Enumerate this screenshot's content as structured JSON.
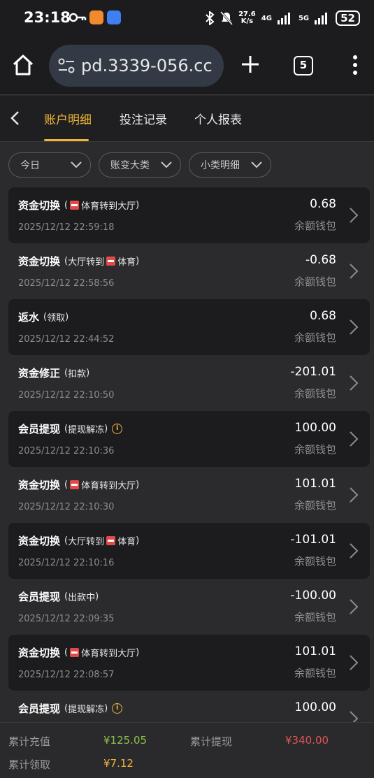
{
  "status_bar": {
    "time": "23:18",
    "net_speed": "27.6",
    "net_unit": "K/s",
    "sig1": "4G",
    "sig2": "5G",
    "battery": "52"
  },
  "browser": {
    "url": "pd.3339-056.cc",
    "tab_count": "5"
  },
  "nav": {
    "tabs": [
      "账户明细",
      "投注记录",
      "个人报表"
    ]
  },
  "filters": [
    "今日",
    "账变大类",
    "小类明细"
  ],
  "records": [
    {
      "title": "资金切换",
      "open": "(",
      "pre": "",
      "post": "体育转到大厅",
      "close": ")",
      "icon": "before",
      "date": "2025/12/12 22:59:18",
      "amount": "0.68",
      "wallet": "余额钱包"
    },
    {
      "title": "资金切换",
      "open": "(",
      "pre": "大厅转到",
      "post": "体育",
      "close": ")",
      "icon": "middle",
      "date": "2025/12/12 22:58:56",
      "amount": "-0.68",
      "wallet": "余额钱包"
    },
    {
      "title": "返水",
      "open": "(",
      "pre": "领取",
      "post": "",
      "close": ")",
      "icon": "none",
      "date": "2025/12/12 22:44:52",
      "amount": "0.68",
      "wallet": "余额钱包"
    },
    {
      "title": "资金修正",
      "open": "(",
      "pre": "扣款",
      "post": "",
      "close": ")",
      "icon": "none",
      "date": "2025/12/12 22:10:50",
      "amount": "-201.01",
      "wallet": "余额钱包"
    },
    {
      "title": "会员提现",
      "open": "(",
      "pre": "提现解冻",
      "post": "",
      "close": ")",
      "icon": "info",
      "date": "2025/12/12 22:10:36",
      "amount": "100.00",
      "wallet": "余额钱包"
    },
    {
      "title": "资金切换",
      "open": "(",
      "pre": "",
      "post": "体育转到大厅",
      "close": ")",
      "icon": "before",
      "date": "2025/12/12 22:10:30",
      "amount": "101.01",
      "wallet": "余额钱包"
    },
    {
      "title": "资金切换",
      "open": "(",
      "pre": "大厅转到",
      "post": "体育",
      "close": ")",
      "icon": "middle",
      "date": "2025/12/12 22:10:16",
      "amount": "-101.01",
      "wallet": "余额钱包"
    },
    {
      "title": "会员提现",
      "open": "(",
      "pre": "出款中",
      "post": "",
      "close": ")",
      "icon": "none",
      "date": "2025/12/12 22:09:35",
      "amount": "-100.00",
      "wallet": "余额钱包"
    },
    {
      "title": "资金切换",
      "open": "(",
      "pre": "",
      "post": "体育转到大厅",
      "close": ")",
      "icon": "before",
      "date": "2025/12/12 22:08:57",
      "amount": "101.01",
      "wallet": "余额钱包"
    },
    {
      "title": "会员提现",
      "open": "(",
      "pre": "提现解冻",
      "post": "",
      "close": ")",
      "icon": "info",
      "date": "",
      "amount": "100.00",
      "wallet": ""
    }
  ],
  "summary": {
    "deposit_label": "累计充值",
    "deposit_value": "¥125.05",
    "withdraw_label": "累计提现",
    "withdraw_value": "¥340.00",
    "claim_label": "累计领取",
    "claim_value": "¥7.12"
  },
  "colors": {
    "accent": "#f0b537",
    "deposit": "#8bc34a",
    "withdraw": "#e05555",
    "claim": "#f0b537"
  }
}
